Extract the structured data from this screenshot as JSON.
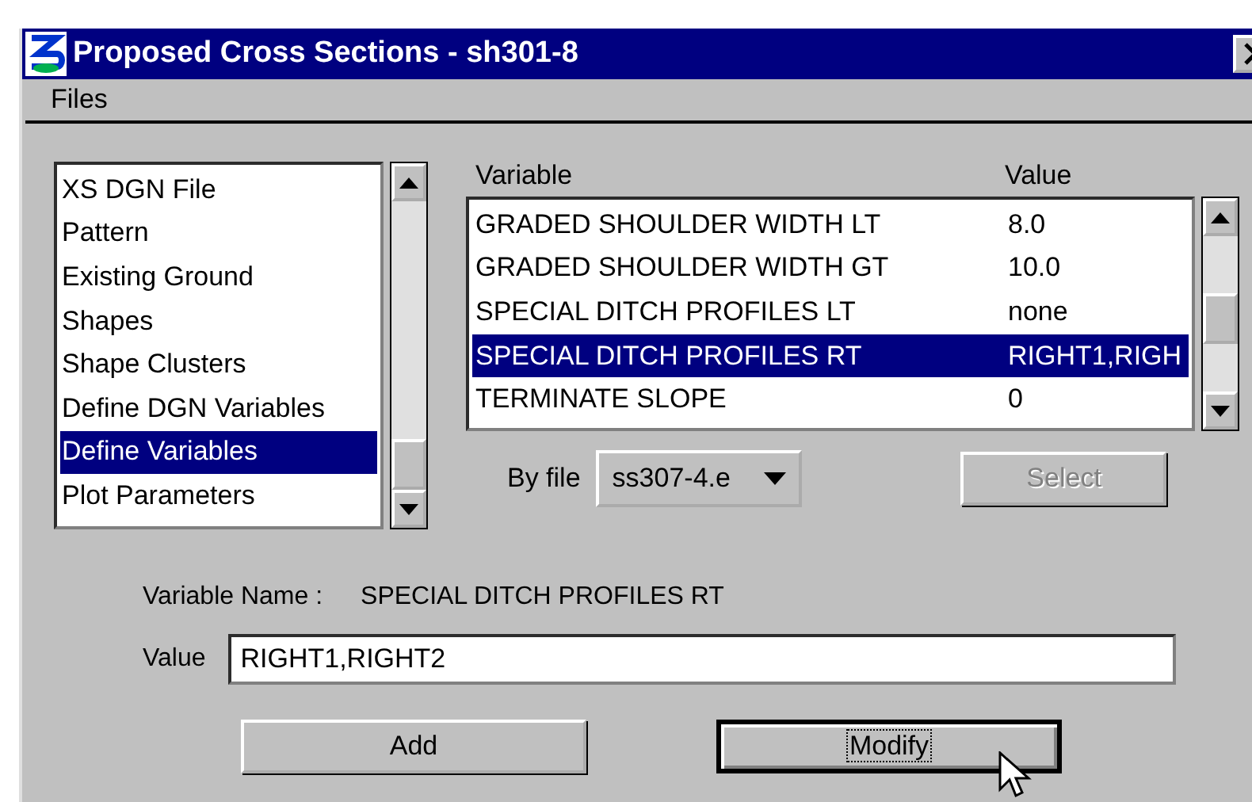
{
  "window": {
    "title": "Proposed Cross Sections - sh301-8"
  },
  "menu": [
    "Files"
  ],
  "categories": [
    {
      "label": "XS DGN File",
      "selected": false
    },
    {
      "label": "Pattern",
      "selected": false
    },
    {
      "label": "Existing Ground",
      "selected": false
    },
    {
      "label": "Shapes",
      "selected": false
    },
    {
      "label": "Shape Clusters",
      "selected": false
    },
    {
      "label": "Define DGN Variables",
      "selected": false
    },
    {
      "label": "Define Variables",
      "selected": true
    },
    {
      "label": "Plot Parameters",
      "selected": false
    }
  ],
  "variables": {
    "columns": [
      "Variable",
      "Value"
    ],
    "rows": [
      {
        "variable": "GRADED SHOULDER WIDTH LT",
        "value": "8.0",
        "selected": false
      },
      {
        "variable": "GRADED SHOULDER WIDTH GT",
        "value": "10.0",
        "selected": false
      },
      {
        "variable": "SPECIAL DITCH PROFILES LT",
        "value": "none",
        "selected": false
      },
      {
        "variable": "SPECIAL DITCH PROFILES RT",
        "value": "RIGHT1,RIGH",
        "selected": true
      },
      {
        "variable": "TERMINATE SLOPE",
        "value": "0",
        "selected": false
      }
    ]
  },
  "by_file": {
    "label": "By file",
    "value": "ss307-4.e"
  },
  "select_button": {
    "label": "Select",
    "disabled": true
  },
  "variable_name": {
    "label": "Variable Name :",
    "value": "SPECIAL DITCH PROFILES RT"
  },
  "value_field": {
    "label": "Value",
    "value": "RIGHT1,RIGHT2"
  },
  "buttons": [
    {
      "label": "Add",
      "focused": false
    },
    {
      "label": "Modify",
      "focused": true
    }
  ]
}
